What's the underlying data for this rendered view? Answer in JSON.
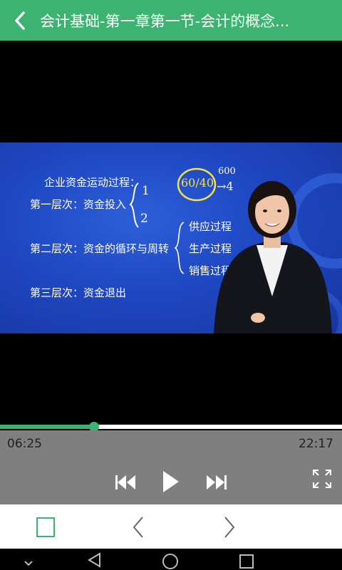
{
  "header": {
    "title": "会计基础-第一章第一节-会计的概念...",
    "back_icon": "chevron-left-icon"
  },
  "slide": {
    "line1": "企业资金运动过程：",
    "line2": "第一层次：资金投入",
    "line3": "第二层次：资金的循环与周转",
    "line4": "第三层次：资金退出",
    "branch1": "供应过程",
    "branch2": "生产过程",
    "branch3": "销售过程",
    "hand1": "1",
    "hand2": "2",
    "hand_circle": "60/40",
    "hand_top": "600",
    "hand_arrow": "→4"
  },
  "player": {
    "progress": 0.275,
    "current_time": "06:25",
    "duration": "22:17",
    "accent_color": "#3cb371"
  },
  "bottom_nav": {
    "fullscreen_icon": "crop-square-icon",
    "prev_icon": "chevron-left-icon",
    "next_icon": "chevron-right-icon"
  },
  "system_nav": {
    "icons": [
      "chevron-down-icon",
      "back-triangle-icon",
      "home-circle-icon",
      "recents-square-icon"
    ]
  }
}
